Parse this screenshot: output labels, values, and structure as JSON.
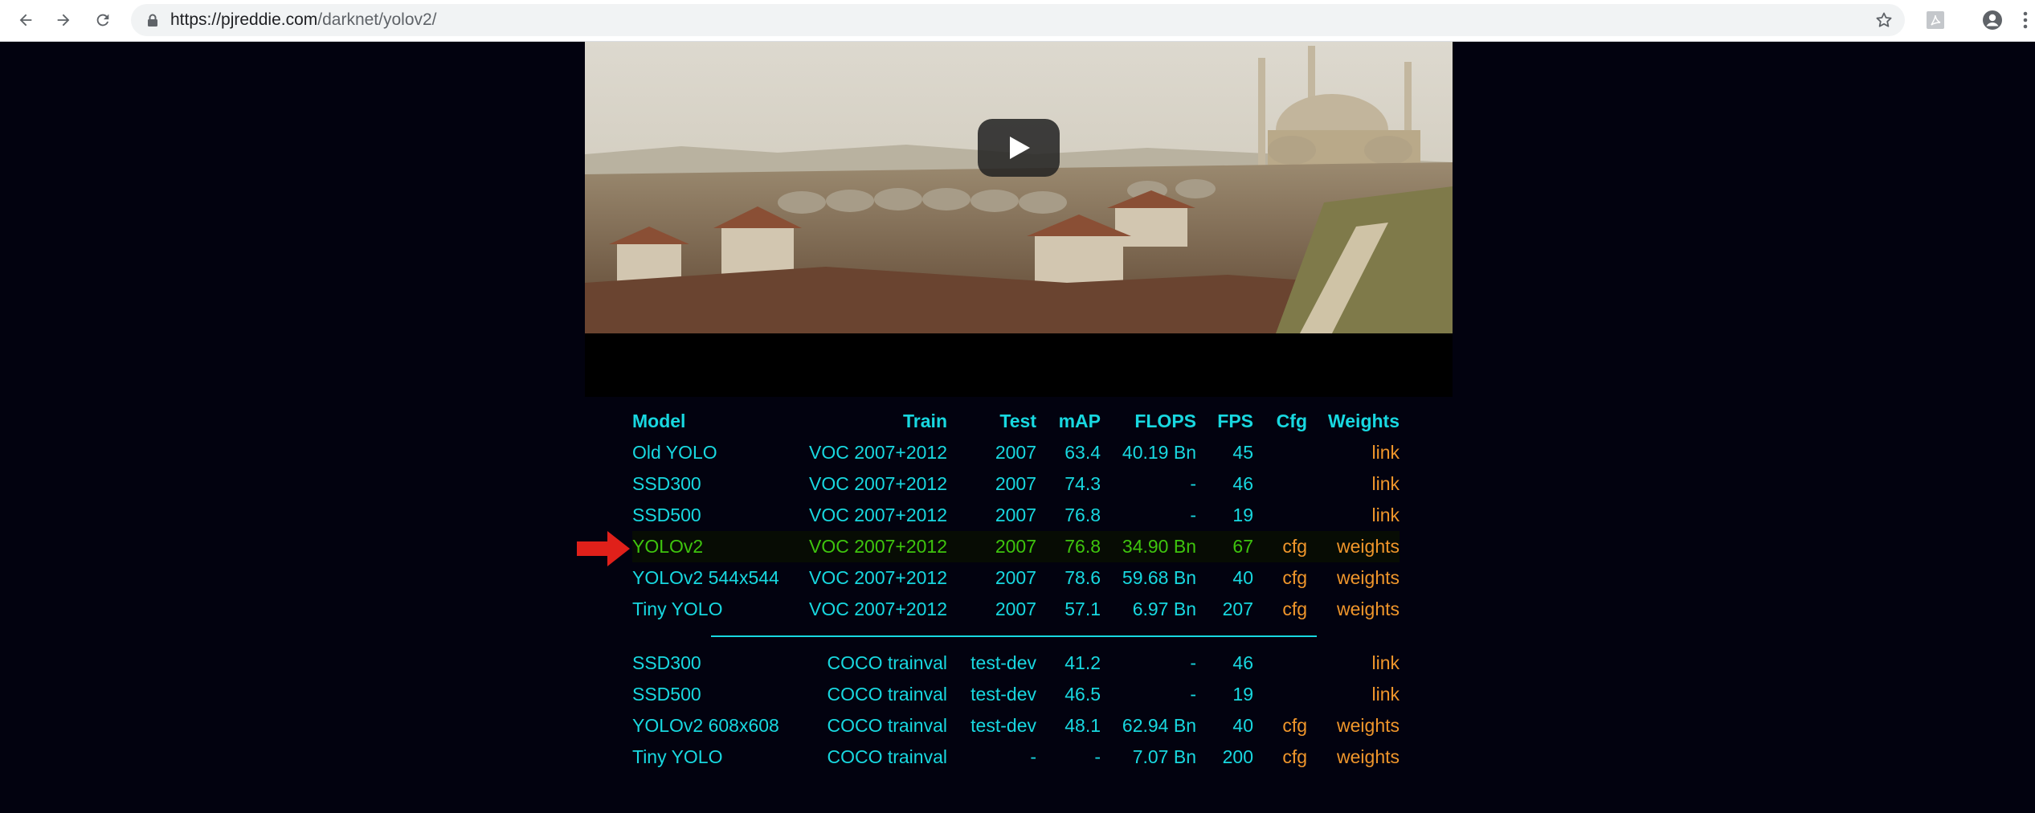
{
  "browser": {
    "url_host": "https://pjreddie.com",
    "url_path": "/darknet/yolov2/",
    "icons": [
      "back-arrow-icon",
      "forward-arrow-icon",
      "reload-icon",
      "lock-icon",
      "bookmark-star-icon",
      "pdf-extension-icon",
      "account-icon",
      "kebab-menu-icon"
    ]
  },
  "video": {
    "icons": [
      "play-icon"
    ]
  },
  "table": {
    "headers": {
      "model": "Model",
      "train": "Train",
      "test": "Test",
      "map": "mAP",
      "flops": "FLOPS",
      "fps": "FPS",
      "cfg": "Cfg",
      "weights": "Weights"
    },
    "voc_rows": [
      {
        "model": "Old YOLO",
        "train": "VOC 2007+2012",
        "test": "2007",
        "map": "63.4",
        "flops": "40.19 Bn",
        "fps": "45",
        "cfg": "",
        "weights": "link"
      },
      {
        "model": "SSD300",
        "train": "VOC 2007+2012",
        "test": "2007",
        "map": "74.3",
        "flops": "-",
        "fps": "46",
        "cfg": "",
        "weights": "link"
      },
      {
        "model": "SSD500",
        "train": "VOC 2007+2012",
        "test": "2007",
        "map": "76.8",
        "flops": "-",
        "fps": "19",
        "cfg": "",
        "weights": "link"
      },
      {
        "model": "YOLOv2",
        "train": "VOC 2007+2012",
        "test": "2007",
        "map": "76.8",
        "flops": "34.90 Bn",
        "fps": "67",
        "cfg": "cfg",
        "weights": "weights"
      },
      {
        "model": "YOLOv2 544x544",
        "train": "VOC 2007+2012",
        "test": "2007",
        "map": "78.6",
        "flops": "59.68 Bn",
        "fps": "40",
        "cfg": "cfg",
        "weights": "weights"
      },
      {
        "model": "Tiny YOLO",
        "train": "VOC 2007+2012",
        "test": "2007",
        "map": "57.1",
        "flops": "6.97 Bn",
        "fps": "207",
        "cfg": "cfg",
        "weights": "weights"
      }
    ],
    "coco_rows": [
      {
        "model": "SSD300",
        "train": "COCO trainval",
        "test": "test-dev",
        "map": "41.2",
        "flops": "-",
        "fps": "46",
        "cfg": "",
        "weights": "link"
      },
      {
        "model": "SSD500",
        "train": "COCO trainval",
        "test": "test-dev",
        "map": "46.5",
        "flops": "-",
        "fps": "19",
        "cfg": "",
        "weights": "link"
      },
      {
        "model": "YOLOv2 608x608",
        "train": "COCO trainval",
        "test": "test-dev",
        "map": "48.1",
        "flops": "62.94 Bn",
        "fps": "40",
        "cfg": "cfg",
        "weights": "weights"
      },
      {
        "model": "Tiny YOLO",
        "train": "COCO trainval",
        "test": "-",
        "map": "-",
        "flops": "7.07 Bn",
        "fps": "200",
        "cfg": "cfg",
        "weights": "weights"
      }
    ],
    "highlighted_model": "YOLOv2",
    "colors": {
      "text": "#18d8e0",
      "link": "#f0962b",
      "highlight": "#3ec40e",
      "arrow": "#e0201a",
      "background": "#02020f"
    }
  }
}
